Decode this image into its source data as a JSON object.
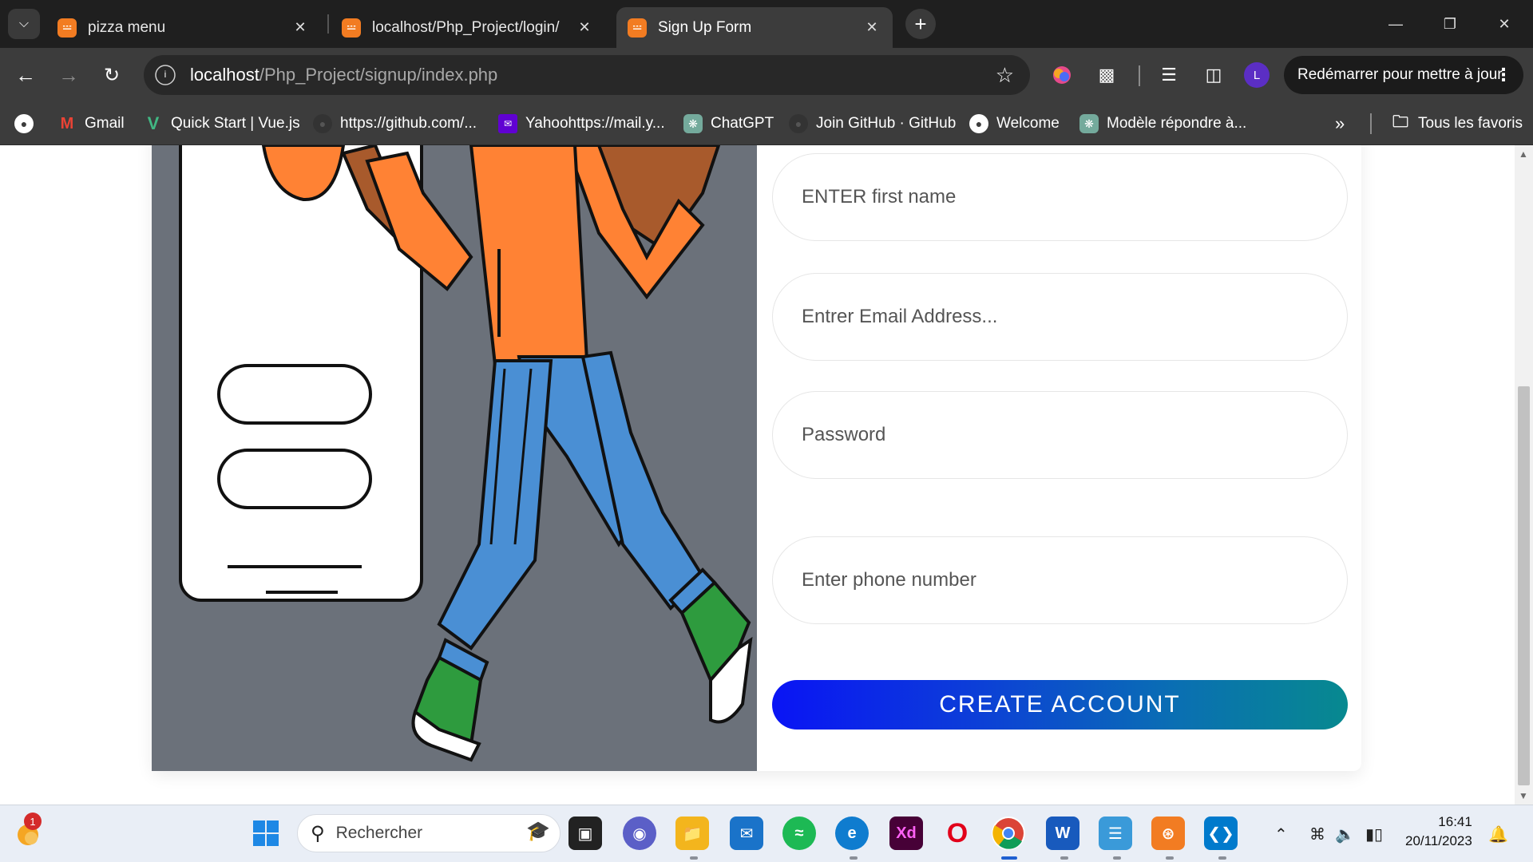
{
  "browser": {
    "tabs": [
      {
        "title": "pizza menu",
        "active": false
      },
      {
        "title": "localhost/Php_Project/login/",
        "active": false
      },
      {
        "title": "Sign Up Form",
        "active": true
      }
    ],
    "address": {
      "host": "localhost",
      "path": "/Php_Project/signup/index.php"
    },
    "restart_label": "Redémarrer pour mettre à jour",
    "profile_initial": "L",
    "bookmarks": [
      {
        "label": "Gmail",
        "icon": "gmail-icon"
      },
      {
        "label": "Quick Start | Vue.js",
        "icon": "vue-icon"
      },
      {
        "label": "https://github.com/...",
        "icon": "github-icon"
      },
      {
        "label": "Yahoohttps://mail.y...",
        "icon": "yahoo-icon"
      },
      {
        "label": "ChatGPT",
        "icon": "chatgpt-icon"
      },
      {
        "label": "Join GitHub · GitHub",
        "icon": "github-icon"
      },
      {
        "label": "Welcome",
        "icon": "globe-icon"
      },
      {
        "label": "Modèle répondre à...",
        "icon": "chatgpt-icon"
      }
    ],
    "all_bookmarks_label": "Tous les favoris"
  },
  "form": {
    "first_name_placeholder": "ENTER first name",
    "email_placeholder": "Entrer Email Address...",
    "password_placeholder": "Password",
    "phone_placeholder": "Enter phone number",
    "submit_label": "CREATE ACCOUNT"
  },
  "taskbar": {
    "search_placeholder": "Rechercher",
    "notification_count": "1",
    "time": "16:41",
    "date": "20/11/2023"
  },
  "colors": {
    "illustration_bg": "#6b717a",
    "button_gradient_start": "#0a14f5",
    "button_gradient_end": "#07898f",
    "shirt": "#ff8234",
    "jeans": "#4a8fd4",
    "shoes": "#2e9b3e"
  }
}
